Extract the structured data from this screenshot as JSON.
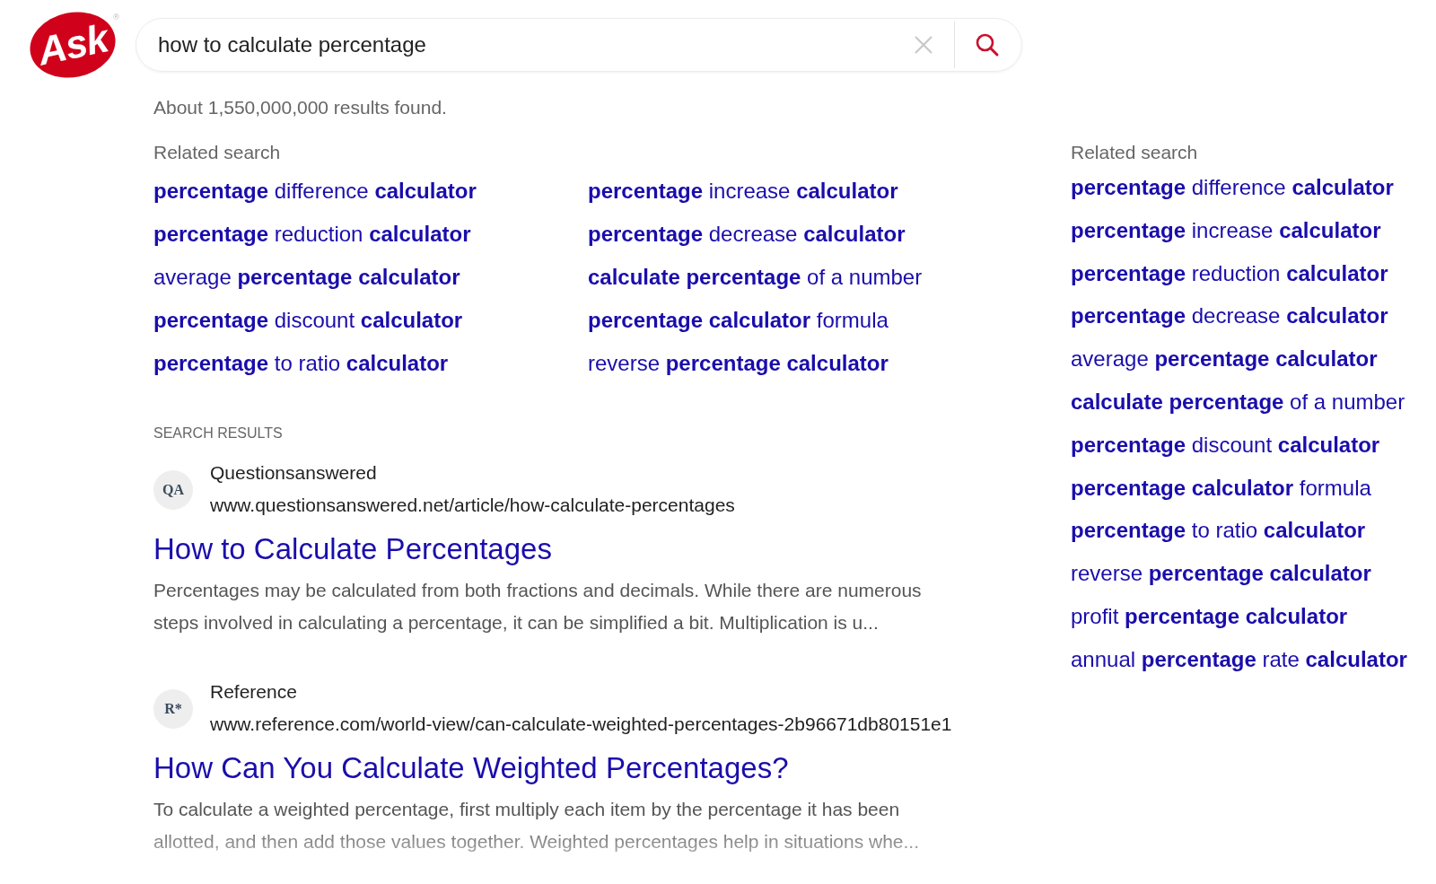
{
  "logo": {
    "text": "Ask",
    "mark": "®"
  },
  "search": {
    "value": "how to calculate percentage"
  },
  "result_count": "About 1,550,000,000 results found.",
  "related_main": {
    "heading": "Related search",
    "columns": [
      [
        "**percentage** difference **calculator**",
        "**percentage** reduction **calculator**",
        "average **percentage calculator**",
        "**percentage** discount **calculator**",
        "**percentage** to ratio **calculator**"
      ],
      [
        "**percentage** increase **calculator**",
        "**percentage** decrease **calculator**",
        "**calculate percentage** of a number",
        "**percentage calculator** formula",
        "reverse **percentage calculator**"
      ]
    ]
  },
  "results_heading": "SEARCH RESULTS",
  "results": [
    {
      "source": "Questionsanswered",
      "favicon": "QA",
      "url": "www.questionsanswered.net/article/how-calculate-percentages",
      "title": "How to Calculate Percentages",
      "snippet": [
        "Percentages may be calculated from both fractions and decimals. While there are numerous",
        "steps involved in calculating a percentage, it can be simplified a bit. Multiplication is u..."
      ],
      "faded": false
    },
    {
      "source": "Reference",
      "favicon": "R*",
      "url": "www.reference.com/world-view/can-calculate-weighted-percentages-2b96671db80151e1",
      "title": "How Can You Calculate Weighted Percentages?",
      "snippet": [
        "To calculate a weighted percentage, first multiply each item by the percentage it has been",
        "allotted, and then add those values together. Weighted percentages help in situations whe..."
      ],
      "faded": true
    }
  ],
  "related_side": {
    "heading": "Related search",
    "items": [
      "**percentage** difference **calculator**",
      "**percentage** increase **calculator**",
      "**percentage** reduction **calculator**",
      "**percentage** decrease **calculator**",
      "average **percentage calculator**",
      "**calculate percentage** of a number",
      "**percentage** discount **calculator**",
      "**percentage calculator** formula",
      "**percentage** to ratio **calculator**",
      "reverse **percentage calculator**",
      "profit **percentage calculator**",
      "annual **percentage** rate **calculator**"
    ]
  }
}
